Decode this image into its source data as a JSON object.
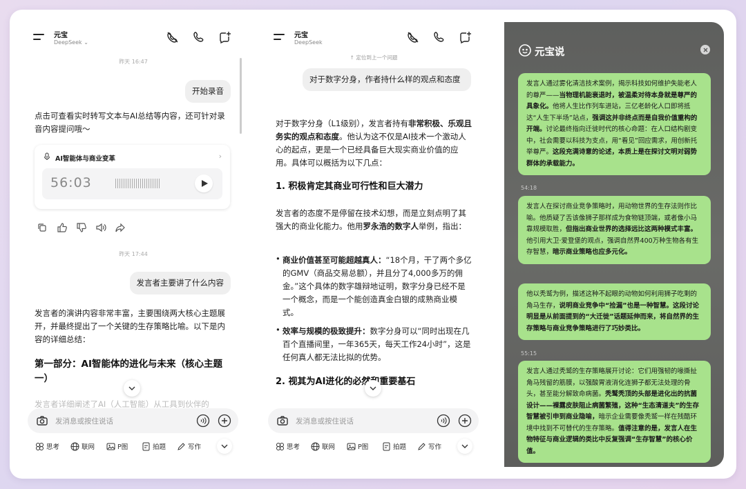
{
  "header": {
    "title": "元宝",
    "subtitle": "DeepSeek"
  },
  "left": {
    "ts1": "昨天 16:47",
    "user_msg1": "开始录音",
    "bot_msg1": "点击可查看实时转写文本与AI总结等内容，还可针对录音内容提问哦～",
    "recording": {
      "title": "AI智能体与商业变革",
      "time": "56:03"
    },
    "ts2": "昨天 17:44",
    "user_msg2": "发言者主要讲了什么内容",
    "bot_msg2": "发言者的演讲内容非常丰富，主要围绕两大核心主题展开，并最终提出了一个关键的生存策略比喻。以下是内容的详细总结：",
    "heading1": "第一部分：AI智能体的进化与未来（核心主题一）",
    "cut_text": "发言者详细阐述了AI（人工智能）从工具到伙伴的"
  },
  "middle": {
    "locate": "定位到上一个问题",
    "user_msg": "对于数字分身，作者持什么样的观点和态度",
    "intro_a": "对于数字分身（L1级别），发言者持有",
    "intro_b": "非常积极、乐观且务实的观点和态度",
    "intro_c": "。他认为这不仅是AI技术一个激动人心的起点，更是一个已经具备巨大现实商业价值的应用。具体可以概括为以下几点：",
    "h1": "1. 积极肯定其商业可行性和巨大潜力",
    "p1a": "发言者的态度不是停留在技术幻想，而是立刻点明了其强大的商业化能力。他用",
    "p1b": "罗永浩的数字人",
    "p1c": "举例，指出：",
    "b1_title": "商业价值甚至可能超越真人：",
    "b1_text": "“18个月，干了两个多亿的GMV（商品交易总额），并且分了4,000多万的佣金。”这个具体的数字雄辩地证明，数字分身已经不是一个概念，而是一个能创造真金白银的成熟商业模式。",
    "b2_title": "效率与规模的极致提升：",
    "b2_text": "数字分身可以“同时出现在几百个直播间里，一年365天，每天工作24小时”，这是任何真人都无法比拟的优势。",
    "h2": "2. 视其为AI进化的必然和重要基石"
  },
  "input": {
    "placeholder": "发消息或按住说话"
  },
  "tools": [
    "思考",
    "联网",
    "P图",
    "拍题",
    "写作"
  ],
  "right": {
    "title": "元宝说",
    "cards": [
      {
        "parts": [
          {
            "t": "发言人通过雾化清洁技术案例，揭示科技如何维护失能老人的尊严——",
            "b": false
          },
          {
            "t": "当物理机能衰退时，被温柔对待本身就是尊严的具象化。",
            "b": true
          },
          {
            "t": "他将人生比作列车进站，三亿老龄化人口即将抵达“人生下半场”站点，",
            "b": false
          },
          {
            "t": "强调这并非终点而是自我价值重构的开端。",
            "b": true
          },
          {
            "t": "讨论最终指向迁徙时代的核心命题：在人口结构剧变中，社会需要以科技为支点，用“看见”回应需求，用创新托举尊严。",
            "b": false
          },
          {
            "t": "这段充满诗意的论述，本质上是在探讨文明对弱势群体的承载能力。",
            "b": true
          }
        ]
      },
      {
        "ts": "54:18",
        "parts": [
          {
            "t": "发言人在探讨商业竞争策略时，用动物世界的生存法则作比喻。他质疑了舌该像狮子那样成为食物链顶端，或者像小马靠规模取胜，",
            "b": false
          },
          {
            "t": "但指出商业世界的选择远比这两种模式丰富。",
            "b": true
          },
          {
            "t": "他引用大卫·爱登堡的观点，强调自然界400万种生物各有生存智慧，",
            "b": false
          },
          {
            "t": "暗示商业策略也应多元化。",
            "b": true
          }
        ]
      },
      {
        "parts": [
          {
            "t": "他以秃鹫为例，描述这种不起眼的动物如何利用狮子吃剩的角马生存，",
            "b": false
          },
          {
            "t": "说明商业竞争中“捡漏”也是一种智慧。这段讨论明显是从前面提到的“大迁徙”话题延伸而来，将自然界的生存策略与商业竞争策略进行了巧妙类比。",
            "b": true
          }
        ]
      },
      {
        "ts": "55:15",
        "parts": [
          {
            "t": "发言人通过秃鹫的生存策略展开讨论：它们用强韧的喙撕扯角马残留的筋膜，以强酸胃液消化连狮子都无法处理的骨头，甚至能分解致命病菌。",
            "b": false
          },
          {
            "t": "秃鹫秃顶的头部是进化出的抗菌设计——裸露皮肤阻止病菌繁殖，这种“生态清道夫”的生存智慧被引申到商业隐喻，",
            "b": true
          },
          {
            "t": "暗示企业需要像秃鹫一样在残酷环境中找到不可替代的生存策略。",
            "b": false
          },
          {
            "t": "值得注意的是，发言人在生物特征与商业逻辑的类比中反复强调“生存智慧”的核心价值。",
            "b": true
          }
        ]
      }
    ]
  }
}
